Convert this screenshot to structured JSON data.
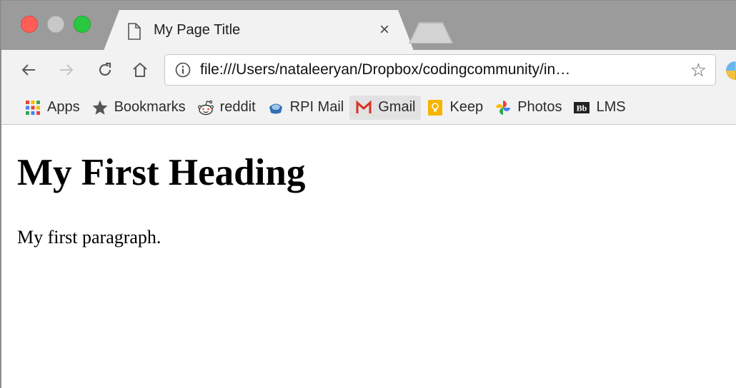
{
  "tab": {
    "title": "My Page Title",
    "close_glyph": "×"
  },
  "toolbar": {
    "url": "file:///Users/nataleeryan/Dropbox/codingcommunity/in…",
    "star_glyph": "☆"
  },
  "bookmarks": [
    {
      "label": "Apps",
      "icon": "apps-grid-icon"
    },
    {
      "label": "Bookmarks",
      "icon": "star-icon"
    },
    {
      "label": "reddit",
      "icon": "reddit-icon"
    },
    {
      "label": "RPI Mail",
      "icon": "rpi-mail-icon"
    },
    {
      "label": "Gmail",
      "icon": "gmail-icon"
    },
    {
      "label": "Keep",
      "icon": "keep-icon"
    },
    {
      "label": "Photos",
      "icon": "photos-icon"
    },
    {
      "label": "LMS",
      "icon": "blackboard-icon"
    }
  ],
  "page": {
    "heading": "My First Heading",
    "paragraph": "My first paragraph."
  },
  "colors": {
    "tabstrip": "#9b9b9b",
    "toolbar": "#f2f2f2",
    "traffic_close": "#fd5f57",
    "traffic_max": "#2ac840",
    "gmail_red": "#d93025",
    "keep_yellow": "#f6b400"
  }
}
